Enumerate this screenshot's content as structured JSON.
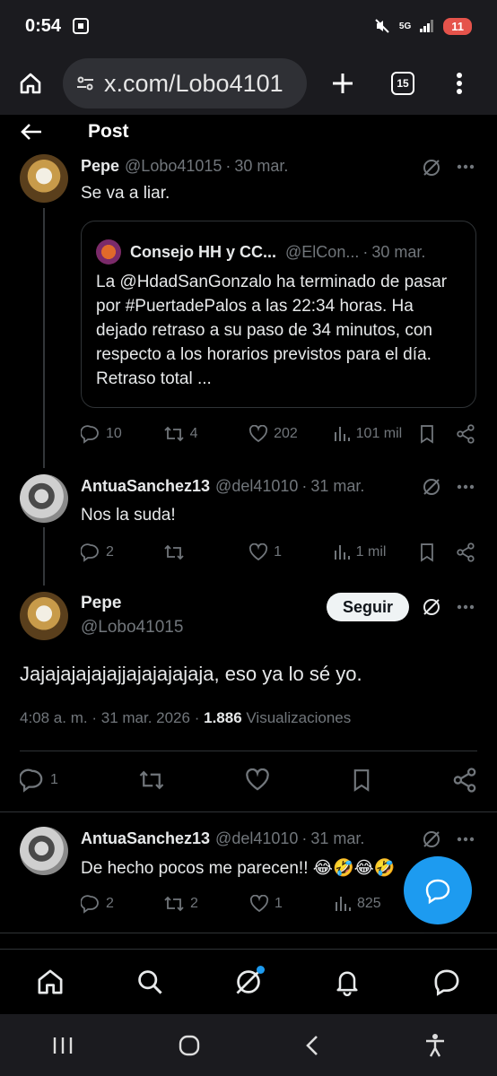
{
  "status": {
    "time": "0:54",
    "network": "5G",
    "battery": "11"
  },
  "browser": {
    "url": "x.com/Lobo4101",
    "tabs_count": "15"
  },
  "header": {
    "title": "Post"
  },
  "tweet1": {
    "name": "Pepe",
    "handle": "@Lobo41015",
    "date": "30 mar.",
    "text": "Se va a liar.",
    "quote": {
      "name": "Consejo HH y CC...",
      "handle": "@ElCon...",
      "date": "30 mar.",
      "text": "La @HdadSanGonzalo ha terminado de pasar por #PuertadePalos a las 22:34 horas. Ha dejado retraso a su paso de 34 minutos, con respecto a los horarios previstos para el día. Retraso total ..."
    },
    "replies": "10",
    "reposts": "4",
    "likes": "202",
    "views": "101 mil"
  },
  "tweet2": {
    "name": "AntuaSanchez13",
    "handle": "@del41010",
    "date": "31 mar.",
    "text": "Nos la suda!",
    "replies": "2",
    "reposts": "",
    "likes": "1",
    "views": "1 mil"
  },
  "main": {
    "name": "Pepe",
    "handle": "@Lobo41015",
    "follow_label": "Seguir",
    "text": "Jajajajajajajjajajajajaja, eso ya lo sé yo.",
    "time": "4:08 a. m.",
    "date": "31 mar. 2026",
    "views_count": "1.886",
    "views_label": "Visualizaciones",
    "replies": "1"
  },
  "tweet3": {
    "name": "AntuaSanchez13",
    "handle": "@del41010",
    "date": "31 mar.",
    "text": "De hecho pocos me parecen!!",
    "emojis": "😂🤣😂🤣",
    "replies": "2",
    "reposts": "2",
    "likes": "1",
    "views": "825"
  },
  "colors": {
    "accent": "#1d9bf0",
    "background": "#000000",
    "muted": "#71767b"
  }
}
